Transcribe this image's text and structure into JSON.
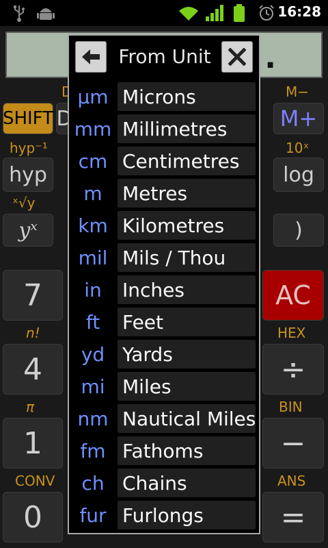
{
  "status_bar": {
    "time": "16:28",
    "icons": [
      "usb-icon",
      "android-debug-icon",
      "wifi-icon",
      "signal-icon",
      "battery-icon",
      "alarm-icon"
    ]
  },
  "calculator": {
    "display_text": ".",
    "labels": {
      "deg_top": "D",
      "m_minus": "M−",
      "hyp_inv": "hyp⁻¹",
      "ten_x": "10ˣ",
      "x_root_y": "ˣ√y",
      "n_fact": "n!",
      "hex": "HEX",
      "pi": "π",
      "bin": "BIN",
      "conv": "CONV",
      "ans": "ANS"
    },
    "keys": {
      "shift": "SHIFT",
      "drg": "D",
      "m_plus": "M+",
      "hyp": "hyp",
      "log": "log",
      "y_x": "yˣ",
      "close_paren": ")",
      "seven": "7",
      "ac": "AC",
      "four": "4",
      "divide": "÷",
      "one": "1",
      "minus": "−",
      "zero": "0",
      "equals": "="
    }
  },
  "dialog": {
    "title": "From Unit",
    "back_label": "back",
    "close_label": "close",
    "units": [
      {
        "abbr": "μm",
        "name": "Microns"
      },
      {
        "abbr": "mm",
        "name": "Millimetres"
      },
      {
        "abbr": "cm",
        "name": "Centimetres"
      },
      {
        "abbr": "m",
        "name": "Metres"
      },
      {
        "abbr": "km",
        "name": "Kilometres"
      },
      {
        "abbr": "mil",
        "name": "Mils / Thou"
      },
      {
        "abbr": "in",
        "name": "Inches"
      },
      {
        "abbr": "ft",
        "name": "Feet"
      },
      {
        "abbr": "yd",
        "name": "Yards"
      },
      {
        "abbr": "mi",
        "name": "Miles"
      },
      {
        "abbr": "nm",
        "name": "Nautical Miles"
      },
      {
        "abbr": "fm",
        "name": "Fathoms"
      },
      {
        "abbr": "ch",
        "name": "Chains"
      },
      {
        "abbr": "fur",
        "name": "Furlongs"
      }
    ]
  },
  "colors": {
    "accent_blue": "#6f8fff",
    "shift_orange": "#c28b1a",
    "ac_red": "#a80000",
    "display_bg": "#a9b8a8"
  }
}
